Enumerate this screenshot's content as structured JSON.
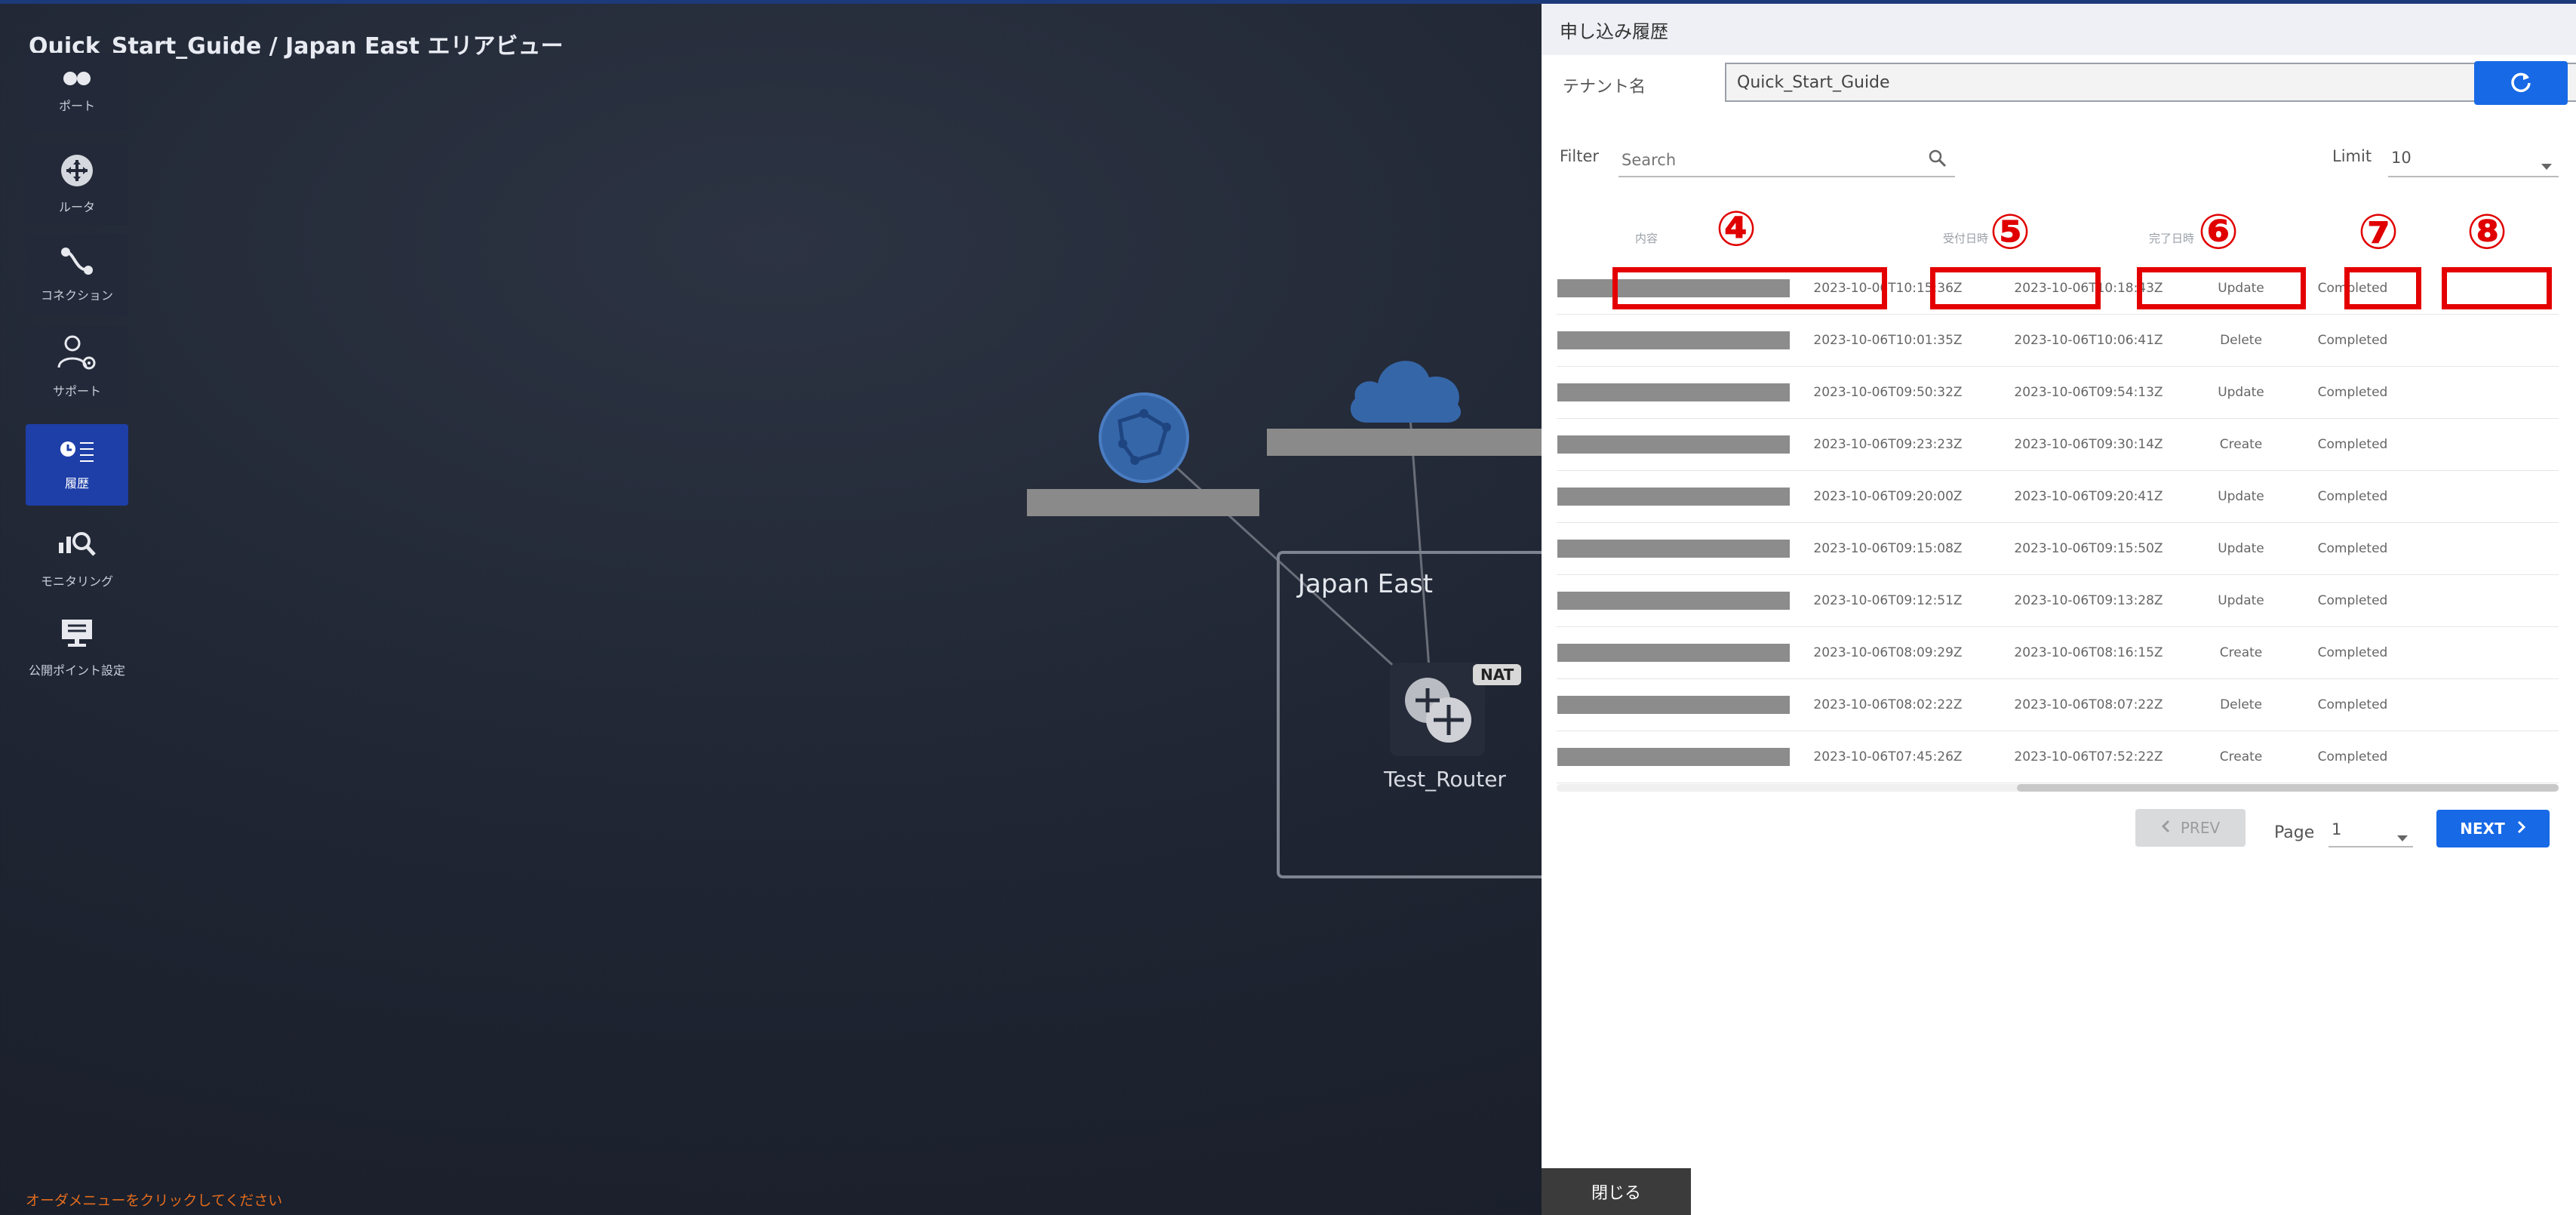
{
  "page": {
    "title": "Quick_Start_Guide / Japan East エリアビュー",
    "hint": "オーダメニューをクリックしてください"
  },
  "sidebar": {
    "items": [
      {
        "label": "ポート",
        "icon": "port-icon"
      },
      {
        "label": "ルータ",
        "icon": "router-icon"
      },
      {
        "label": "コネクション",
        "icon": "connection-icon"
      },
      {
        "label": "サポート",
        "icon": "support-icon"
      },
      {
        "label": "履歴",
        "icon": "history-icon",
        "active": true
      },
      {
        "label": "モニタリング",
        "icon": "monitoring-icon"
      },
      {
        "label": "公開ポイント設定",
        "icon": "public-point-icon"
      }
    ]
  },
  "topology": {
    "area_label": "Japan East",
    "router_name": "Test_Router",
    "nat_badge": "NAT"
  },
  "panel": {
    "title": "申し込み履歴",
    "tenant_label": "テナント名",
    "tenant_value": "Quick_Start_Guide",
    "filter_label": "Filter",
    "search_placeholder": "Search",
    "limit_label": "Limit",
    "limit_value": "10",
    "columns": [
      "内容",
      "受付日時",
      "完了日時",
      "",
      ""
    ],
    "callouts": [
      "④",
      "⑤",
      "⑥",
      "⑦",
      "⑧"
    ],
    "rows": [
      {
        "received": "2023-10-06T10:15:36Z",
        "completed": "2023-10-06T10:18:43Z",
        "type": "Update",
        "status": "Completed"
      },
      {
        "received": "2023-10-06T10:01:35Z",
        "completed": "2023-10-06T10:06:41Z",
        "type": "Delete",
        "status": "Completed"
      },
      {
        "received": "2023-10-06T09:50:32Z",
        "completed": "2023-10-06T09:54:13Z",
        "type": "Update",
        "status": "Completed"
      },
      {
        "received": "2023-10-06T09:23:23Z",
        "completed": "2023-10-06T09:30:14Z",
        "type": "Create",
        "status": "Completed"
      },
      {
        "received": "2023-10-06T09:20:00Z",
        "completed": "2023-10-06T09:20:41Z",
        "type": "Update",
        "status": "Completed"
      },
      {
        "received": "2023-10-06T09:15:08Z",
        "completed": "2023-10-06T09:15:50Z",
        "type": "Update",
        "status": "Completed"
      },
      {
        "received": "2023-10-06T09:12:51Z",
        "completed": "2023-10-06T09:13:28Z",
        "type": "Update",
        "status": "Completed"
      },
      {
        "received": "2023-10-06T08:09:29Z",
        "completed": "2023-10-06T08:16:15Z",
        "type": "Create",
        "status": "Completed"
      },
      {
        "received": "2023-10-06T08:02:22Z",
        "completed": "2023-10-06T08:07:22Z",
        "type": "Delete",
        "status": "Completed"
      },
      {
        "received": "2023-10-06T07:45:26Z",
        "completed": "2023-10-06T07:52:22Z",
        "type": "Create",
        "status": "Completed"
      }
    ],
    "prev_label": "PREV",
    "page_label": "Page",
    "page_value": "1",
    "next_label": "NEXT",
    "close_label": "閉じる"
  },
  "colors": {
    "accent": "#1769e6",
    "highlight": "#e40000",
    "active_nav": "#1e3fa8",
    "hint_text": "#e36b1d"
  }
}
